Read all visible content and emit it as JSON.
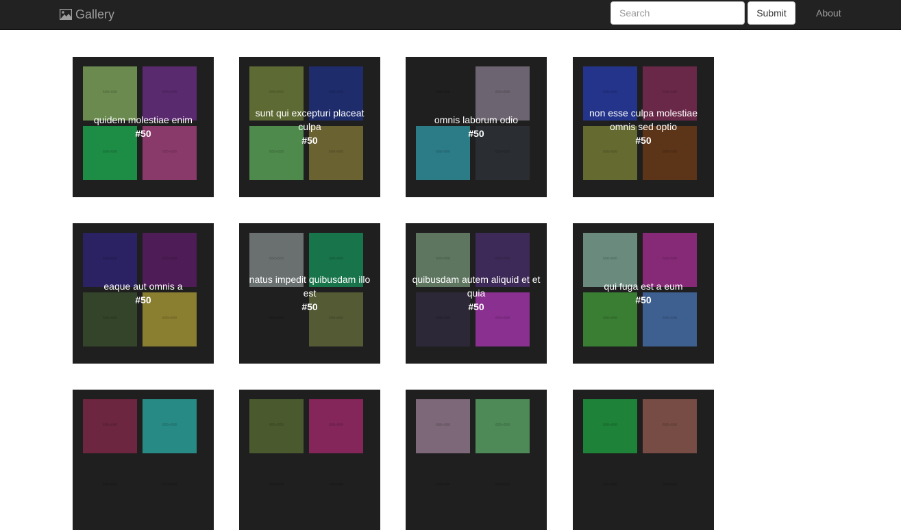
{
  "navbar": {
    "brand_label": "Gallery",
    "brand_icon": "picture-icon",
    "search_placeholder": "Search",
    "search_value": "",
    "submit_label": "Submit",
    "about_label": "About"
  },
  "thumb_label": "600×600",
  "albums": [
    {
      "title": "quidem molestiae enim",
      "count": "#50",
      "colors": [
        "#6a8a4f",
        "#5a2a6e",
        "#1d8c45",
        "#8a3a6a"
      ]
    },
    {
      "title": "sunt qui excepturi placeat culpa",
      "count": "#50",
      "colors": [
        "#5e6a34",
        "#1f2c6c",
        "#4e8a4c",
        "#6b6232"
      ]
    },
    {
      "title": "omnis laborum odio",
      "count": "#50",
      "colors": [
        "#1f1f1f",
        "#6c6470",
        "#2c7c88",
        "#2a2e32"
      ]
    },
    {
      "title": "non esse culpa molestiae omnis sed optio",
      "count": "#50",
      "colors": [
        "#24348a",
        "#6a2848",
        "#646a30",
        "#5c3418"
      ]
    },
    {
      "title": "eaque aut omnis a",
      "count": "#50",
      "colors": [
        "#2a2262",
        "#4e1c56",
        "#34442a",
        "#8a7e30"
      ]
    },
    {
      "title": "natus impedit quibusdam illo est",
      "count": "#50",
      "colors": [
        "#6a7070",
        "#18744a",
        "#1f1f1f",
        "#545a34"
      ]
    },
    {
      "title": "quibusdam autem aliquid et et quia",
      "count": "#50",
      "colors": [
        "#5e7660",
        "#3e2a58",
        "#2c2838",
        "#8a3090"
      ]
    },
    {
      "title": "qui fuga est a eum",
      "count": "#50",
      "colors": [
        "#6a8a7e",
        "#862a78",
        "#3a7e34",
        "#3e6090"
      ]
    },
    {
      "title": "",
      "count": "",
      "colors": [
        "#6c2640",
        "#288a84",
        "#1f1f1f",
        "#1f1f1f"
      ]
    },
    {
      "title": "",
      "count": "",
      "colors": [
        "#4a5a2e",
        "#84265a",
        "#1f1f1f",
        "#1f1f1f"
      ]
    },
    {
      "title": "",
      "count": "",
      "colors": [
        "#7c6878",
        "#4e8a58",
        "#1f1f1f",
        "#1f1f1f"
      ]
    },
    {
      "title": "",
      "count": "",
      "colors": [
        "#1e8238",
        "#764c44",
        "#1f1f1f",
        "#1f1f1f"
      ]
    }
  ]
}
